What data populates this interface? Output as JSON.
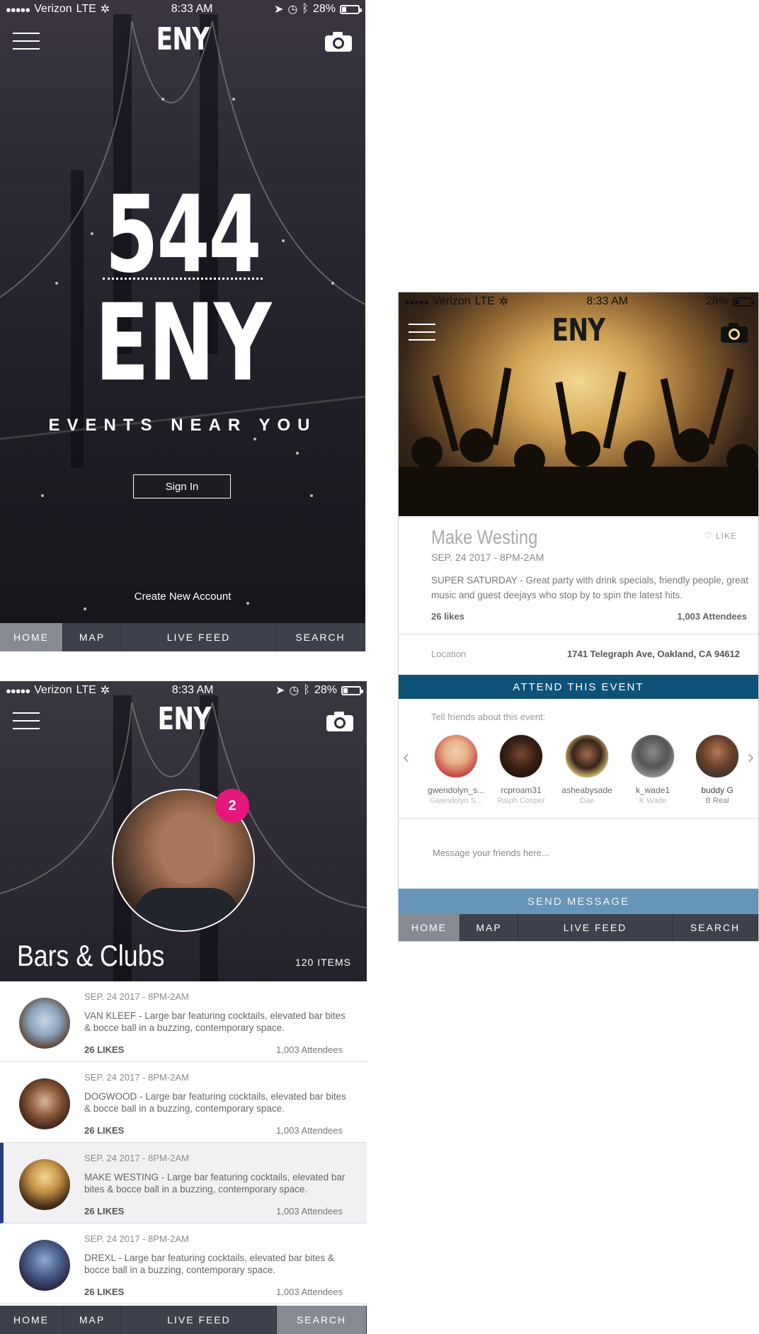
{
  "status": {
    "carrier": "Verizon",
    "network": "LTE",
    "time": "8:33 AM",
    "battery": "28%"
  },
  "brand": "ENY",
  "icons": [
    "menu-icon",
    "camera-icon",
    "location-arrow-icon",
    "alarm-icon",
    "bluetooth-icon",
    "battery-icon",
    "heart-icon",
    "chevron-left-icon",
    "chevron-right-icon"
  ],
  "colors": {
    "attend": "#0e5277",
    "send": "#6795b8",
    "badge": "#e5177a",
    "tabbar": "#3e414b",
    "tab_active": "#878a93",
    "selected_border": "#24407f"
  },
  "tabs": [
    "HOME",
    "MAP",
    "LIVE FEED",
    "SEARCH"
  ],
  "welcome": {
    "count": "544",
    "title": "ENY",
    "tagline": "EVENTS NEAR YOU",
    "sign_in": "Sign In",
    "create_account": "Create New Account",
    "active_tab": "HOME"
  },
  "listing": {
    "badge": "2",
    "section_title": "Bars & Clubs",
    "items_count": "120 ITEMS",
    "active_tab": "SEARCH",
    "items": [
      {
        "date": "SEP. 24 2017 - 8PM-2AM",
        "desc": "VAN KLEEF - Large bar featuring cocktails, elevated bar bites & bocce ball in a buzzing, contemporary space.",
        "likes": "26 LIKES",
        "attendees": "1,003 Attendees"
      },
      {
        "date": "SEP. 24 2017 - 8PM-2AM",
        "desc": "DOGWOOD - Large bar featuring cocktails, elevated bar bites & bocce ball in a buzzing, contemporary space.",
        "likes": "26 LIKES",
        "attendees": "1,003 Attendees"
      },
      {
        "date": "SEP. 24 2017 - 8PM-2AM",
        "desc": "MAKE WESTING - Large bar featuring cocktails, elevated bar bites & bocce ball in a buzzing, contemporary space.",
        "likes": "26 LIKES",
        "attendees": "1,003 Attendees"
      },
      {
        "date": "SEP. 24 2017 - 8PM-2AM",
        "desc": "DREXL - Large bar featuring cocktails, elevated bar bites & bocce ball in a buzzing, contemporary space.",
        "likes": "26 LIKES",
        "attendees": "1,003 Attendees"
      }
    ]
  },
  "event": {
    "title": "Make Westing",
    "like": "LIKE",
    "date": "SEP. 24 2017 - 8PM-2AM",
    "desc": "SUPER SATURDAY - Great party with drink specials, friendly people, great music and guest deejays who stop by to spin the latest hits.",
    "likes": "26 likes",
    "attendees": "1,003 Attendees",
    "location_label": "Location",
    "location": "1741 Telegraph Ave, Oakland, CA 94612",
    "attend_button": "ATTEND THIS EVENT",
    "tell_friends": "Tell friends about this event:",
    "friends": [
      {
        "username": "gwendolyn_s...",
        "name": "Gwendolyn S..."
      },
      {
        "username": "rcproam31",
        "name": "Ralph Cooper"
      },
      {
        "username": "asheabysade",
        "name": "Dae"
      },
      {
        "username": "k_wade1",
        "name": "K Wade"
      },
      {
        "username": "buddy G",
        "name": "B Real"
      }
    ],
    "message_placeholder": "Message your friends here...",
    "send_button": "SEND MESSAGE",
    "active_tab": "HOME"
  }
}
